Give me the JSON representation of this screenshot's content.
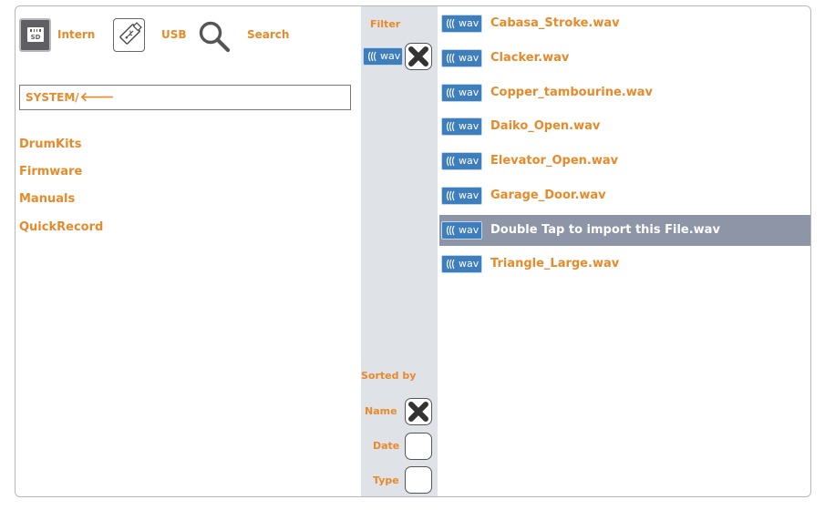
{
  "sources": {
    "intern_label": "Intern",
    "usb_label": "USB",
    "search_label": "Search",
    "sd_card_text": "SD"
  },
  "path": {
    "value": "SYSTEM/",
    "back_glyph": "🡐"
  },
  "folders": [
    "DrumKits",
    "Firmware",
    "Manuals",
    "QuickRecord"
  ],
  "filter": {
    "label": "Filter",
    "type_badge": "wav"
  },
  "sort": {
    "label": "Sorted by",
    "options": [
      {
        "label": "Name",
        "checked": true
      },
      {
        "label": "Date",
        "checked": false
      },
      {
        "label": "Type",
        "checked": false
      }
    ]
  },
  "files": [
    {
      "badge": "wav",
      "name": "Cabasa_Stroke.wav",
      "selected": false
    },
    {
      "badge": "wav",
      "name": "Clacker.wav",
      "selected": false
    },
    {
      "badge": "wav",
      "name": "Copper_tambourine.wav",
      "selected": false
    },
    {
      "badge": "wav",
      "name": "Daiko_Open.wav",
      "selected": false
    },
    {
      "badge": "wav",
      "name": "Elevator_Open.wav",
      "selected": false
    },
    {
      "badge": "wav",
      "name": "Garage_Door.wav",
      "selected": false
    },
    {
      "badge": "wav",
      "name": "Double Tap to import this File.wav",
      "selected": true
    },
    {
      "badge": "wav",
      "name": "Triangle_Large.wav",
      "selected": false
    }
  ],
  "colors": {
    "accent": "#e88a2a",
    "badge_blue": "#3e7ebd",
    "selected_row": "#8d95a6",
    "panel": "#dfe3e8"
  },
  "icons": {
    "intern": "sd-card-icon",
    "usb": "usb-stick-icon",
    "search": "magnifier-icon",
    "back": "left-arrow-icon",
    "badge": "sound-wave-icon",
    "checkbox": "x-checkbox-icon"
  }
}
